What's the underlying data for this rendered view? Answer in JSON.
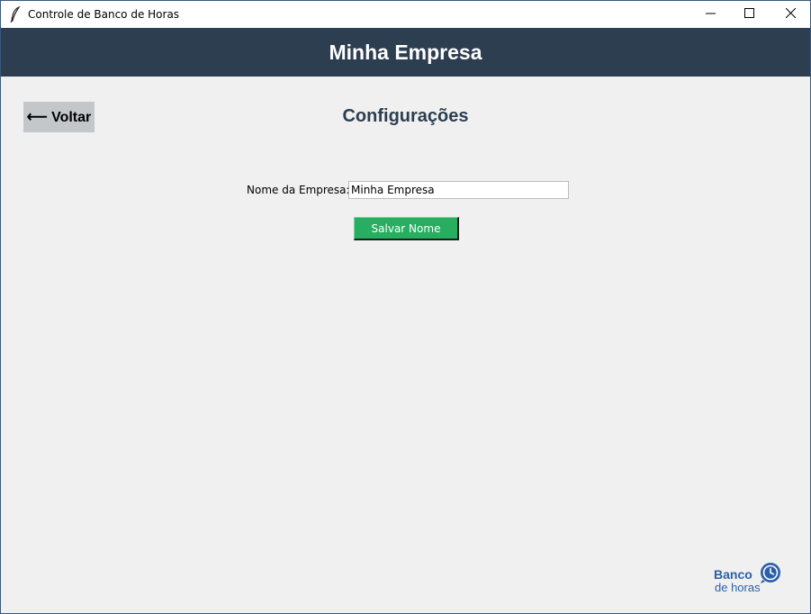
{
  "window": {
    "title": "Controle de Banco de Horas",
    "controls": {
      "minimize": "minimize-icon",
      "maximize": "maximize-icon",
      "close": "close-icon"
    }
  },
  "header": {
    "title": "Minha Empresa"
  },
  "colors": {
    "header_bg": "#2c3e50",
    "page_bg": "#f0f0f0",
    "save_button": "#27ae60",
    "back_button": "#c4c7ca",
    "logo": "#2c5fa8"
  },
  "toolbar": {
    "back_label": "⟵ Voltar"
  },
  "main": {
    "title": "Configurações",
    "form": {
      "company_name_label": "Nome da Empresa:",
      "company_name_value": "Minha Empresa",
      "save_label": "Salvar Nome"
    }
  },
  "logo": {
    "line1": "Banco",
    "line2": "de horas",
    "icon": "clock-icon"
  }
}
